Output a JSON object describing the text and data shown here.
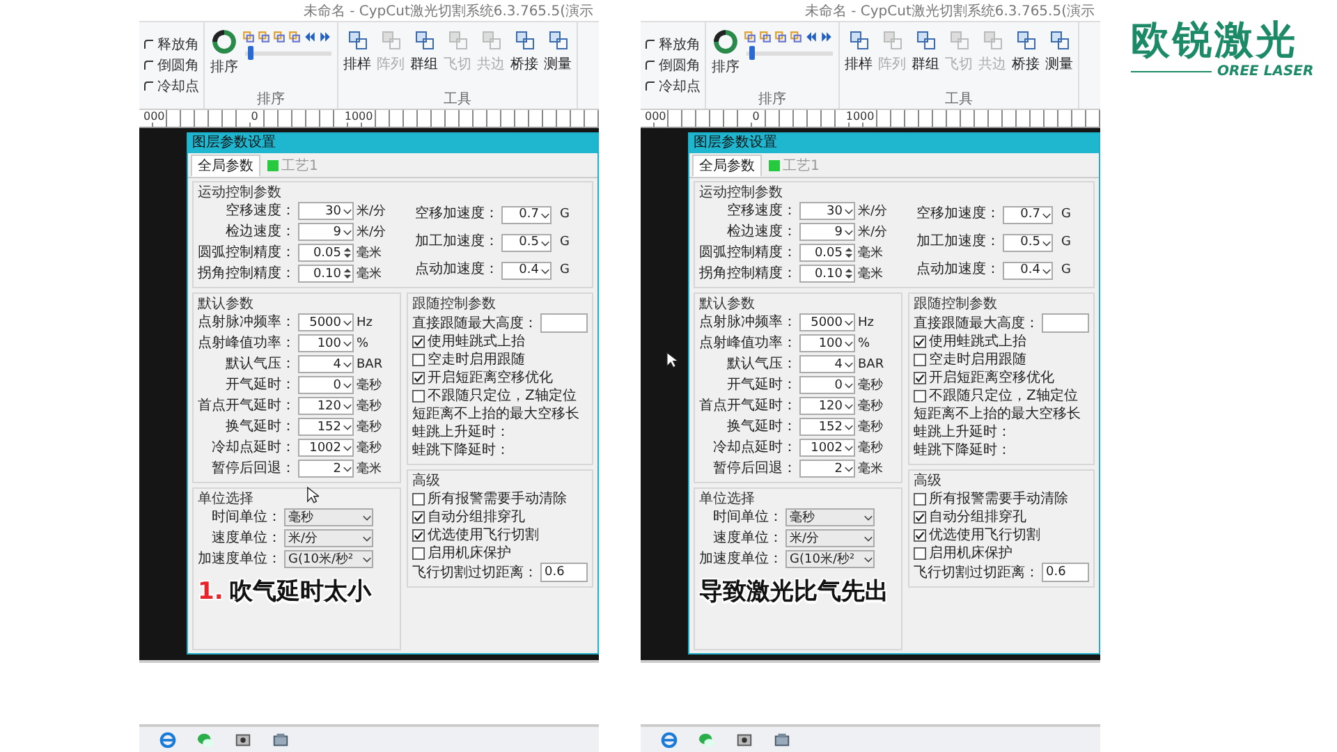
{
  "panels": [
    {
      "app_title": "未命名 - CypCut激光切割系统6.3.765.5(演示",
      "ribbon": {
        "corner_items": [
          {
            "label": "释放角"
          },
          {
            "label": "倒圆角"
          },
          {
            "label": "冷却点"
          }
        ],
        "sort_button": "排序",
        "sort_group": "排序",
        "slider": {
          "level": 0.04
        },
        "tools": [
          {
            "label": "排样",
            "disabled": false
          },
          {
            "label": "阵列",
            "disabled": true
          },
          {
            "label": "群组",
            "disabled": false
          },
          {
            "label": "飞切",
            "disabled": true
          },
          {
            "label": "共边",
            "disabled": true
          },
          {
            "label": "桥接",
            "disabled": false
          },
          {
            "label": "测量",
            "disabled": false
          }
        ],
        "tools_group": "工具"
      },
      "ruler": [
        "000",
        "0",
        "1000"
      ],
      "dialog": {
        "title": "图层参数设置",
        "tabs": [
          {
            "label": "全局参数",
            "selected": true
          },
          {
            "label": "工艺1",
            "selected": false,
            "color": "#27c93f"
          }
        ],
        "motion": {
          "heading": "运动控制参数",
          "left": [
            {
              "label": "空移速度：",
              "value": "30",
              "unit": "米/分",
              "kind": "dropdown"
            },
            {
              "label": "检边速度：",
              "value": "9",
              "unit": "米/分",
              "kind": "dropdown"
            },
            {
              "label": "圆弧控制精度：",
              "value": "0.05",
              "unit": "毫米",
              "kind": "spin"
            },
            {
              "label": "拐角控制精度：",
              "value": "0.10",
              "unit": "毫米",
              "kind": "spin"
            }
          ],
          "right": [
            {
              "label": "空移加速度：",
              "value": "0.7",
              "unit": "G",
              "kind": "dropdown"
            },
            {
              "label": "加工加速度：",
              "value": "0.5",
              "unit": "G",
              "kind": "dropdown"
            },
            {
              "label": "点动加速度：",
              "value": "0.4",
              "unit": "G",
              "kind": "dropdown"
            }
          ]
        },
        "defaults": {
          "heading": "默认参数",
          "fields": [
            {
              "label": "点射脉冲频率：",
              "value": "5000",
              "unit": "Hz",
              "kind": "dropdown"
            },
            {
              "label": "点射峰值功率：",
              "value": "100",
              "unit": "%",
              "kind": "dropdown"
            },
            {
              "label": "默认气压：",
              "value": "4",
              "unit": "BAR",
              "kind": "dropdown"
            },
            {
              "label": "开气延时：",
              "value": "0",
              "unit": "毫秒",
              "kind": "dropdown"
            },
            {
              "label": "首点开气延时：",
              "value": "120",
              "unit": "毫秒",
              "kind": "dropdown"
            },
            {
              "label": "换气延时：",
              "value": "152",
              "unit": "毫秒",
              "kind": "dropdown"
            },
            {
              "label": "冷却点延时：",
              "value": "1002",
              "unit": "毫秒",
              "kind": "dropdown"
            },
            {
              "label": "暂停后回退：",
              "value": "2",
              "unit": "毫米",
              "kind": "dropdown"
            }
          ]
        },
        "follow": {
          "heading": "跟随控制参数",
          "items": [
            {
              "kind": "field",
              "label": "直接跟随最大高度："
            },
            {
              "kind": "checkbox",
              "label": "使用蛙跳式上抬",
              "checked": true
            },
            {
              "kind": "checkbox",
              "label": "空走时启用跟随",
              "checked": false
            },
            {
              "kind": "checkbox",
              "label": "开启短距离空移优化",
              "checked": true
            },
            {
              "kind": "checkbox",
              "label": "不跟随只定位，Z轴定位",
              "checked": false
            },
            {
              "kind": "text",
              "label": "短距离不上抬的最大空移长"
            },
            {
              "kind": "text",
              "label": "蛙跳上升延时："
            },
            {
              "kind": "text",
              "label": "蛙跳下降延时："
            }
          ]
        },
        "units": {
          "heading": "单位选择",
          "fields": [
            {
              "label": "时间单位：",
              "value": "毫秒"
            },
            {
              "label": "速度单位：",
              "value": "米/分"
            },
            {
              "label": "加速度单位：",
              "value": "G(10米/秒²"
            }
          ]
        },
        "advanced": {
          "heading": "高级",
          "items": [
            {
              "kind": "checkbox",
              "label": "所有报警需要手动清除",
              "checked": false
            },
            {
              "kind": "checkbox",
              "label": "自动分组排穿孔",
              "checked": true
            },
            {
              "kind": "checkbox",
              "label": "优选使用飞行切割",
              "checked": true
            },
            {
              "kind": "checkbox",
              "label": "启用机床保护",
              "checked": false
            },
            {
              "kind": "field",
              "label": "飞行切割过切距离：",
              "value": "0.6"
            }
          ]
        }
      },
      "subtitle": {
        "number": "1.",
        "text": "吹气延时太小"
      }
    },
    {
      "app_title": "未命名 - CypCut激光切割系统6.3.765.5(演示",
      "ribbon": {
        "corner_items": [
          {
            "label": "释放角"
          },
          {
            "label": "倒圆角"
          },
          {
            "label": "冷却点"
          }
        ],
        "sort_button": "排序",
        "sort_group": "排序",
        "slider": {
          "level": 0.04
        },
        "tools": [
          {
            "label": "排样",
            "disabled": false
          },
          {
            "label": "阵列",
            "disabled": true
          },
          {
            "label": "群组",
            "disabled": false
          },
          {
            "label": "飞切",
            "disabled": true
          },
          {
            "label": "共边",
            "disabled": true
          },
          {
            "label": "桥接",
            "disabled": false
          },
          {
            "label": "测量",
            "disabled": false
          }
        ],
        "tools_group": "工具"
      },
      "ruler": [
        "000",
        "0",
        "1000"
      ],
      "dialog": {
        "title": "图层参数设置",
        "tabs": [
          {
            "label": "全局参数",
            "selected": true
          },
          {
            "label": "工艺1",
            "selected": false,
            "color": "#27c93f"
          }
        ],
        "motion": {
          "heading": "运动控制参数",
          "left": [
            {
              "label": "空移速度：",
              "value": "30",
              "unit": "米/分",
              "kind": "dropdown"
            },
            {
              "label": "检边速度：",
              "value": "9",
              "unit": "米/分",
              "kind": "dropdown"
            },
            {
              "label": "圆弧控制精度：",
              "value": "0.05",
              "unit": "毫米",
              "kind": "spin"
            },
            {
              "label": "拐角控制精度：",
              "value": "0.10",
              "unit": "毫米",
              "kind": "spin"
            }
          ],
          "right": [
            {
              "label": "空移加速度：",
              "value": "0.7",
              "unit": "G",
              "kind": "dropdown"
            },
            {
              "label": "加工加速度：",
              "value": "0.5",
              "unit": "G",
              "kind": "dropdown"
            },
            {
              "label": "点动加速度：",
              "value": "0.4",
              "unit": "G",
              "kind": "dropdown"
            }
          ]
        },
        "defaults": {
          "heading": "默认参数",
          "fields": [
            {
              "label": "点射脉冲频率：",
              "value": "5000",
              "unit": "Hz",
              "kind": "dropdown"
            },
            {
              "label": "点射峰值功率：",
              "value": "100",
              "unit": "%",
              "kind": "dropdown"
            },
            {
              "label": "默认气压：",
              "value": "4",
              "unit": "BAR",
              "kind": "dropdown"
            },
            {
              "label": "开气延时：",
              "value": "0",
              "unit": "毫秒",
              "kind": "dropdown"
            },
            {
              "label": "首点开气延时：",
              "value": "120",
              "unit": "毫秒",
              "kind": "dropdown"
            },
            {
              "label": "换气延时：",
              "value": "152",
              "unit": "毫秒",
              "kind": "dropdown"
            },
            {
              "label": "冷却点延时：",
              "value": "1002",
              "unit": "毫秒",
              "kind": "dropdown"
            },
            {
              "label": "暂停后回退：",
              "value": "2",
              "unit": "毫米",
              "kind": "dropdown"
            }
          ]
        },
        "follow": {
          "heading": "跟随控制参数",
          "items": [
            {
              "kind": "field",
              "label": "直接跟随最大高度："
            },
            {
              "kind": "checkbox",
              "label": "使用蛙跳式上抬",
              "checked": true
            },
            {
              "kind": "checkbox",
              "label": "空走时启用跟随",
              "checked": false
            },
            {
              "kind": "checkbox",
              "label": "开启短距离空移优化",
              "checked": true
            },
            {
              "kind": "checkbox",
              "label": "不跟随只定位，Z轴定位",
              "checked": false
            },
            {
              "kind": "text",
              "label": "短距离不上抬的最大空移长"
            },
            {
              "kind": "text",
              "label": "蛙跳上升延时："
            },
            {
              "kind": "text",
              "label": "蛙跳下降延时："
            }
          ]
        },
        "units": {
          "heading": "单位选择",
          "fields": [
            {
              "label": "时间单位：",
              "value": "毫秒"
            },
            {
              "label": "速度单位：",
              "value": "米/分"
            },
            {
              "label": "加速度单位：",
              "value": "G(10米/秒²"
            }
          ]
        },
        "advanced": {
          "heading": "高级",
          "items": [
            {
              "kind": "checkbox",
              "label": "所有报警需要手动清除",
              "checked": false
            },
            {
              "kind": "checkbox",
              "label": "自动分组排穿孔",
              "checked": true
            },
            {
              "kind": "checkbox",
              "label": "优选使用飞行切割",
              "checked": true
            },
            {
              "kind": "checkbox",
              "label": "启用机床保护",
              "checked": false
            },
            {
              "kind": "field",
              "label": "飞行切割过切距离：",
              "value": "0.6"
            }
          ]
        }
      },
      "subtitle": {
        "text": "导致激光比气先出"
      }
    }
  ],
  "logo": {
    "name": "欧锐激光",
    "tagline": "OREE LASER"
  }
}
